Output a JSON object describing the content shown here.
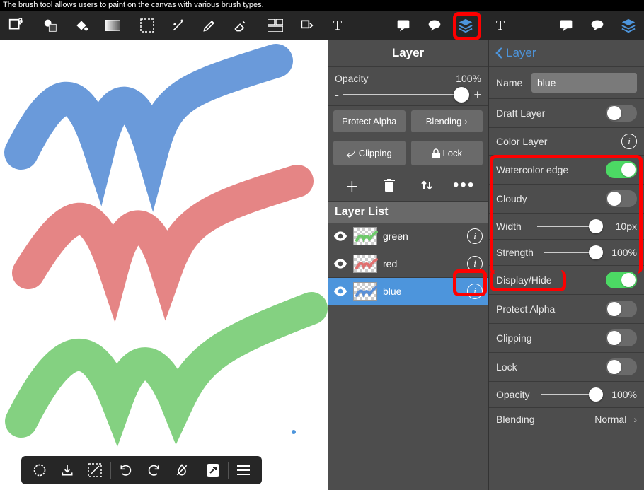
{
  "top_note": "The brush tool allows users to paint on the canvas with various brush types.",
  "toolbar_icons": [
    "fullscreen",
    "shapes",
    "bucket",
    "gradient",
    "marquee",
    "wand",
    "pencil",
    "eraser",
    "panel",
    "transform",
    "text"
  ],
  "right_toolbar_icons": [
    "comment",
    "chat",
    "layers-icon",
    "text",
    "comment",
    "chat",
    "layers-icon"
  ],
  "layer_panel": {
    "title": "Layer",
    "opacity_label": "Opacity",
    "opacity_value": "100%",
    "minus": "-",
    "plus": "+",
    "protect_alpha": "Protect Alpha",
    "blending": "Blending",
    "clipping": "Clipping",
    "lock": "Lock",
    "list_header": "Layer List",
    "layers": [
      {
        "name": "green",
        "selected": false,
        "stroke": "#6ec96b"
      },
      {
        "name": "red",
        "selected": false,
        "stroke": "#e07070"
      },
      {
        "name": "blue",
        "selected": true,
        "stroke": "#5a8fd6"
      }
    ]
  },
  "layer_detail": {
    "back": "Layer",
    "name_label": "Name",
    "name_value": "blue",
    "rows": {
      "draft": "Draft Layer",
      "color_layer": "Color Layer",
      "watercolor": "Watercolor edge",
      "cloudy": "Cloudy",
      "width": "Width",
      "width_val": "10px",
      "strength": "Strength",
      "strength_val": "100%",
      "display": "Display/Hide",
      "protect_alpha": "Protect Alpha",
      "clipping": "Clipping",
      "lock": "Lock",
      "opacity": "Opacity",
      "opacity_val": "100%",
      "blending": "Blending",
      "blending_val": "Normal"
    }
  }
}
